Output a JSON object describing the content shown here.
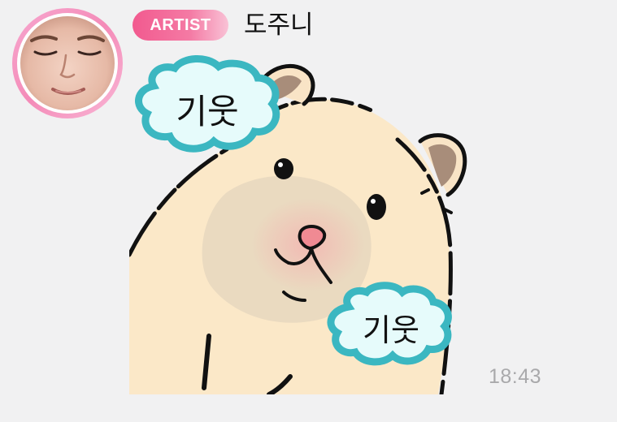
{
  "message": {
    "sender_badge": "ARTIST",
    "sender_name": "도주니",
    "time": "18:43",
    "sticker": {
      "bubble_text_top": "기웃",
      "bubble_text_bottom": "기웃"
    }
  },
  "icons": {
    "avatar": "profile-photo",
    "sticker": "peeking-hamster-sticker"
  },
  "colors": {
    "background": "#f1f1f2",
    "badge_gradient_start": "#f25a8f",
    "badge_gradient_end": "#f9c2d6",
    "avatar_ring": "#f48bb8",
    "timestamp": "#a9a9ab",
    "bubble_fill": "#e6fbfb",
    "bubble_border": "#3bb7c1"
  }
}
